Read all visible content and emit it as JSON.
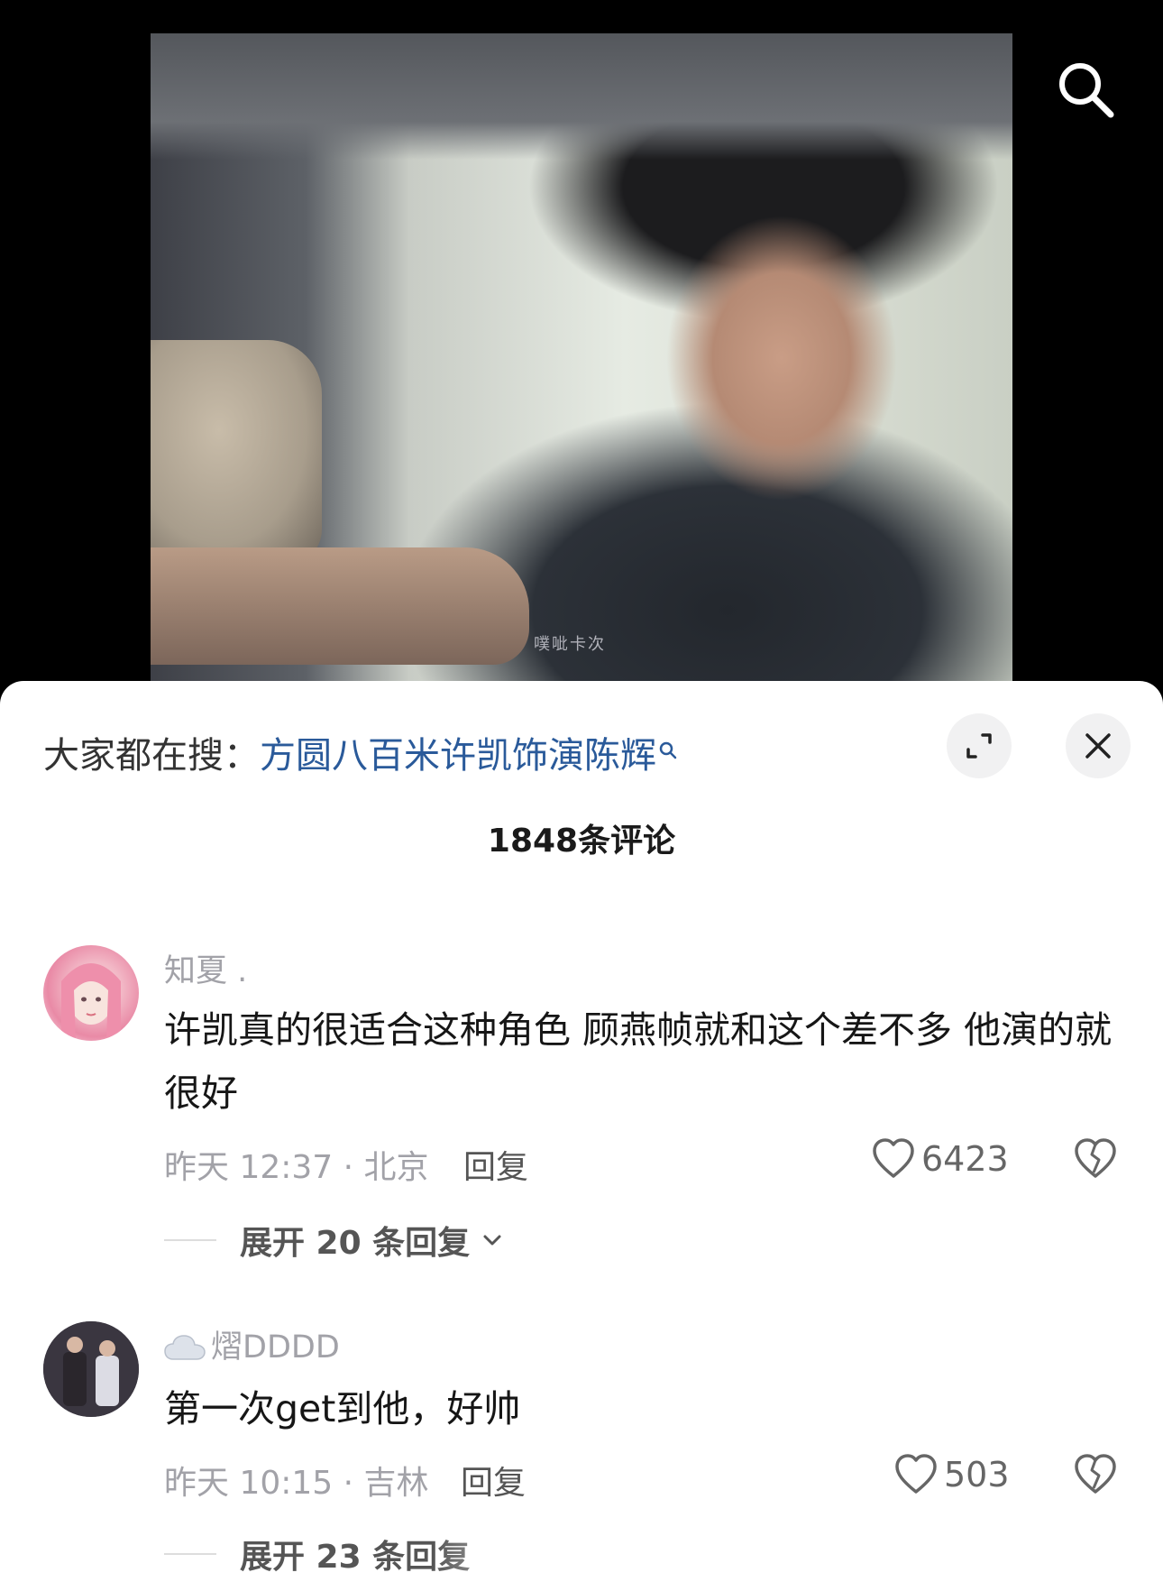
{
  "video": {
    "watermark": "噗呲卡次"
  },
  "icons": {
    "search": "search-icon",
    "expand": "expand-icon",
    "close": "close-icon",
    "heart": "heart-icon",
    "dislike": "broken-heart-icon",
    "chevron": "chevron-down-icon",
    "cloud": "cloud-icon"
  },
  "hot_search": {
    "prefix": "大家都在搜：",
    "keyword": "方圆八百米许凯饰演陈辉"
  },
  "comments_title": "1848条评论",
  "comments": [
    {
      "username": "知夏 .",
      "text": "许凯真的很适合这种角色  顾燕帧就和这个差不多 他演的就很好",
      "meta": "昨天 12:37 · 北京",
      "reply_label": "回复",
      "likes": "6423",
      "expand_label": "展开 20 条回复"
    },
    {
      "username": "熠DDDD",
      "text": "第一次get到他，好帅",
      "meta": "昨天 10:15 · 吉林",
      "reply_label": "回复",
      "likes": "503",
      "expand_label": "展开 23 条回复"
    }
  ],
  "colors": {
    "keyword_blue": "#2a5a9a",
    "meta_gray": "#a2a2a8",
    "sheet_bg": "#ffffff"
  }
}
